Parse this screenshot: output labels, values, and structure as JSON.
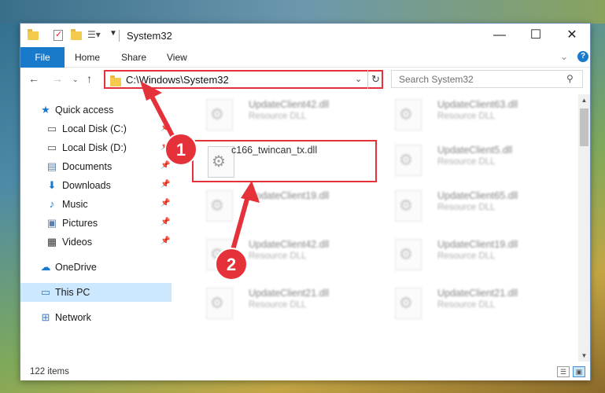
{
  "window": {
    "title": "System32",
    "controls": {
      "minimize": "—",
      "maximize": "☐",
      "close": "✕"
    }
  },
  "ribbon": {
    "tabs": [
      {
        "label": "File"
      },
      {
        "label": "Home"
      },
      {
        "label": "Share"
      },
      {
        "label": "View"
      }
    ]
  },
  "navbar": {
    "address": "C:\\Windows\\System32",
    "search_placeholder": "Search System32"
  },
  "sidebar": {
    "items": [
      {
        "label": "Quick access",
        "icon": "star-icon"
      },
      {
        "label": "Local Disk (C:)",
        "icon": "drive-icon"
      },
      {
        "label": "Local Disk (D:)",
        "icon": "drive-icon"
      },
      {
        "label": "Documents",
        "icon": "documents-icon"
      },
      {
        "label": "Downloads",
        "icon": "download-icon"
      },
      {
        "label": "Music",
        "icon": "music-icon"
      },
      {
        "label": "Pictures",
        "icon": "pictures-icon"
      },
      {
        "label": "Videos",
        "icon": "videos-icon"
      },
      {
        "label": "OneDrive",
        "icon": "cloud-icon"
      },
      {
        "label": "This PC",
        "icon": "computer-icon"
      },
      {
        "label": "Network",
        "icon": "network-icon"
      }
    ]
  },
  "files": {
    "selected": {
      "name": "c166_twincan_tx.dll"
    },
    "left_column": [
      {
        "name": "UpdateClient42.dll",
        "type": "Resource DLL"
      },
      {
        "name": "UpdateClient19.dll",
        "type": "Resource DLL"
      },
      {
        "name": "UpdateClient42.dll",
        "type": "Resource DLL"
      },
      {
        "name": "UpdateClient21.dll",
        "type": "Resource DLL"
      }
    ],
    "right_column": [
      {
        "name": "UpdateClient63.dll",
        "type": "Resource DLL"
      },
      {
        "name": "UpdateClient5.dll",
        "type": "Resource DLL"
      },
      {
        "name": "UpdateClient65.dll",
        "type": "Resource DLL"
      },
      {
        "name": "UpdateClient19.dll",
        "type": "Resource DLL"
      },
      {
        "name": "UpdateClient21.dll",
        "type": "Resource DLL"
      }
    ]
  },
  "status": {
    "item_count": "122 items"
  },
  "annotations": {
    "step1": "1",
    "step2": "2",
    "color": "#e4313a"
  },
  "colors": {
    "accent": "#1979ca",
    "highlight": "#e4313a",
    "selection": "#cce8ff"
  }
}
